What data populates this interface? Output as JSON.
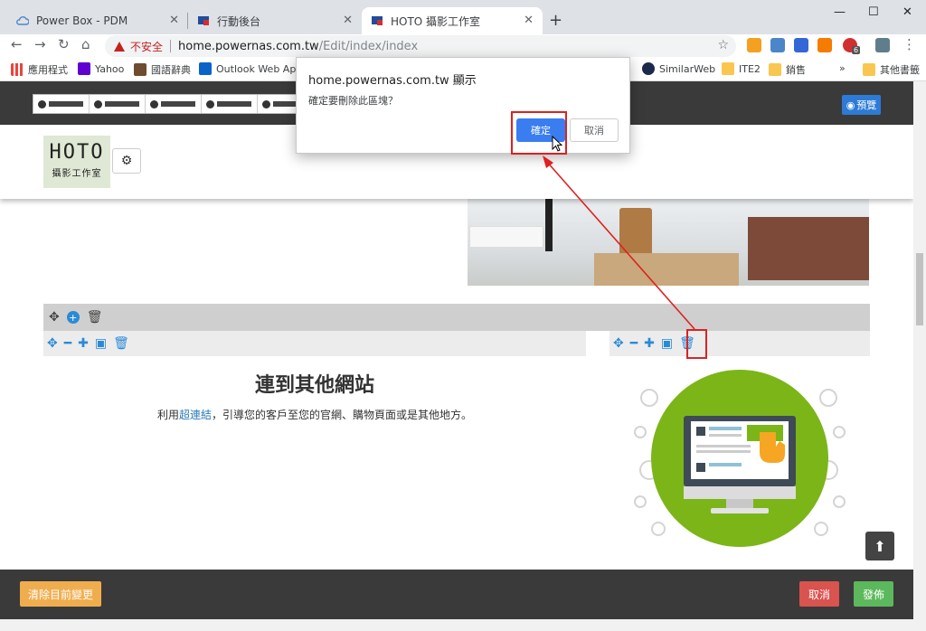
{
  "browser": {
    "tabs": [
      {
        "title": "Power Box - PDM",
        "icon": "cloud-icon"
      },
      {
        "title": "行動後台",
        "icon": "site-icon"
      },
      {
        "title": "HOTO 攝影工作室",
        "icon": "site-icon",
        "active": true
      }
    ],
    "new_tab": "+",
    "window_controls": {
      "minimize": "—",
      "maximize": "☐",
      "close": "✕"
    },
    "address": {
      "security_label": "不安全",
      "host": "home.powernas.com.tw",
      "path": "/Edit/index/index"
    },
    "bookmarks": [
      {
        "label": "應用程式",
        "icon": "apps-grid-icon"
      },
      {
        "label": "Yahoo",
        "icon": "yahoo-icon"
      },
      {
        "label": "國語辭典",
        "icon": "dictionary-icon"
      },
      {
        "label": "Outlook Web App",
        "icon": "outlook-icon"
      },
      {
        "label": "SimilarWeb",
        "icon": "similarweb-icon"
      },
      {
        "label": "ITE2",
        "icon": "folder-icon"
      },
      {
        "label": "銷售",
        "icon": "folder-icon"
      },
      {
        "label": "»",
        "icon": "overflow-icon"
      },
      {
        "label": "其他書籤",
        "icon": "folder-icon"
      }
    ],
    "extension_badge": "6"
  },
  "dialog": {
    "title": "home.powernas.com.tw 顯示",
    "message": "確定要刪除此區塊？",
    "ok_label": "確定",
    "cancel_label": "取消"
  },
  "editor": {
    "preview_label": "預覽",
    "clear_label": "清除目前變更",
    "cancel_label": "取消",
    "publish_label": "發佈"
  },
  "site": {
    "logo_main": "HOTO",
    "logo_sub": "攝影工作室",
    "headline": "連到其他網站",
    "sub_prefix": "利用",
    "sub_link": "超連結",
    "sub_suffix": "，引導您的客戶至您的官網、購物頁面或是其他地方。"
  },
  "colors": {
    "accent_blue": "#3a7df0",
    "danger_red": "#d9534f",
    "success_green": "#5cb85c",
    "warning_orange": "#f0ad4e",
    "editor_dark": "#3a3a3a",
    "annotation_red": "#e02020"
  }
}
